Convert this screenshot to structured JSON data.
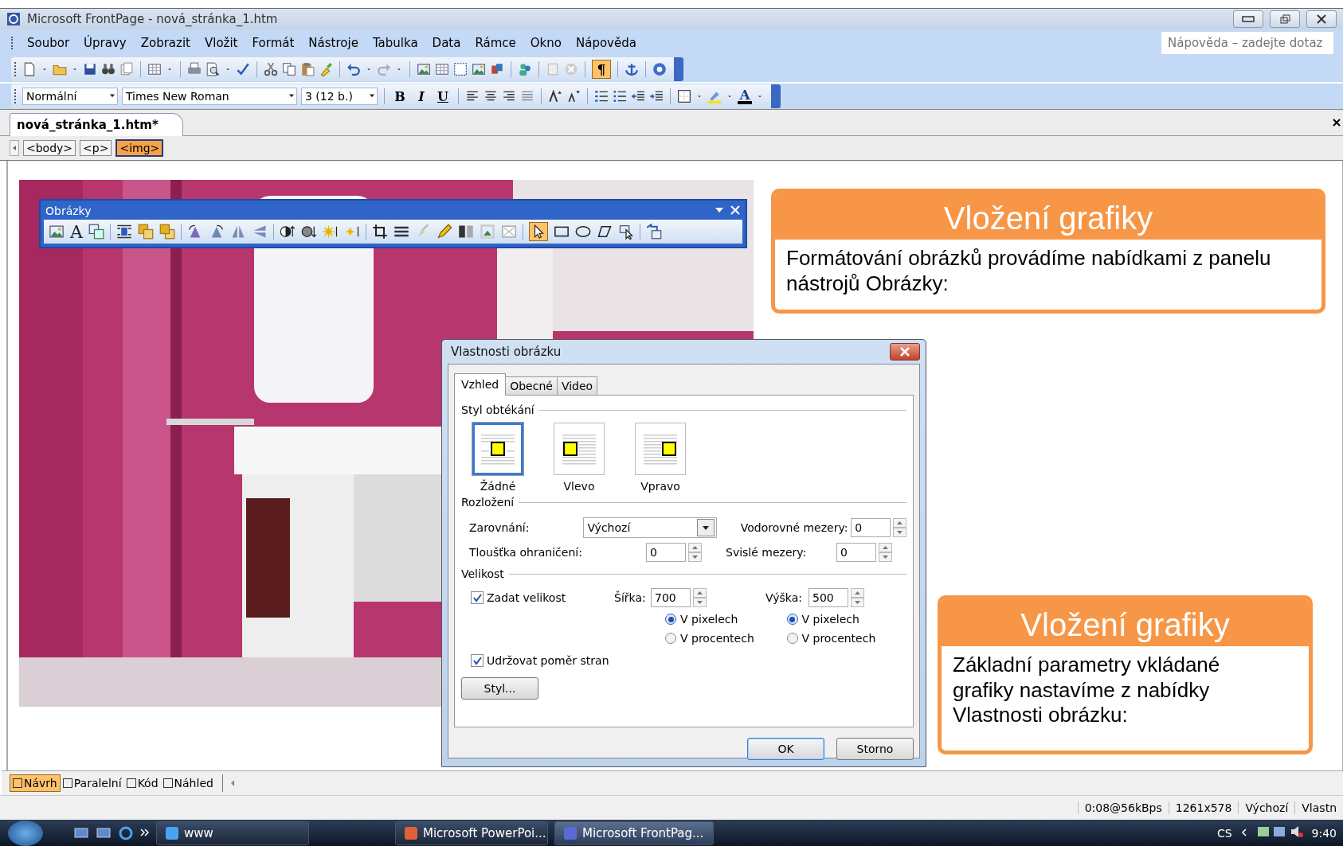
{
  "window": {
    "title": "Microsoft FrontPage - nová_stránka_1.htm"
  },
  "menu": [
    {
      "label": "Soubor"
    },
    {
      "label": "Úpravy"
    },
    {
      "label": "Zobrazit"
    },
    {
      "label": "Vložit"
    },
    {
      "label": "Formát"
    },
    {
      "label": "Nástroje"
    },
    {
      "label": "Tabulka"
    },
    {
      "label": "Data"
    },
    {
      "label": "Rámce"
    },
    {
      "label": "Okno"
    },
    {
      "label": "Nápověda"
    }
  ],
  "help_search": {
    "placeholder": "Nápověda – zadejte dotaz"
  },
  "toolbars": {
    "standard": {
      "pilcrow": {
        "label": "¶",
        "selected": true
      }
    },
    "formatting": {
      "style": "Normální",
      "font": "Times New Roman",
      "size": "3 (12 b.)",
      "buttons": [
        {
          "label": "B",
          "kind": "bold"
        },
        {
          "label": "I",
          "kind": "italic"
        },
        {
          "label": "U",
          "kind": "underline"
        }
      ],
      "font_color": {
        "label": "A"
      }
    }
  },
  "document_tab": {
    "label": "nová_stránka_1.htm*"
  },
  "tag_path": [
    {
      "label": "<body>",
      "selected": false
    },
    {
      "label": "<p>",
      "selected": false
    },
    {
      "label": "<img>",
      "selected": true
    }
  ],
  "pictures_toolbar": {
    "title": "Obrázky",
    "text_tool": "A",
    "pointer_selected": true
  },
  "callouts": [
    {
      "title": "Vložení grafiky",
      "text": "Formátování obrázků provádíme nabídkami z panelu nástrojů Obrázky:"
    },
    {
      "title": "Vložení grafiky",
      "text": "Základní parametry vkládané grafiky nastavíme z nabídky Vlastnosti obrázku:"
    }
  ],
  "dialog": {
    "title": "Vlastnosti obrázku",
    "tabs": [
      {
        "label": "Vzhled",
        "selected": true
      },
      {
        "label": "Obecné",
        "selected": false
      },
      {
        "label": "Video",
        "selected": false
      }
    ],
    "wrap_label": "Styl obtékání",
    "wrap_options": [
      {
        "label": "Žádné",
        "kind": "none",
        "selected": true
      },
      {
        "label": "Vlevo",
        "kind": "left",
        "selected": false
      },
      {
        "label": "Vpravo",
        "kind": "right",
        "selected": false
      }
    ],
    "layout_label": "Rozložení",
    "alignment": {
      "label": "Zarovnání:",
      "value": "Výchozí"
    },
    "border": {
      "label": "Tloušťka ohraničení:",
      "value": "0"
    },
    "hspace": {
      "label": "Vodorovné mezery:",
      "value": "0"
    },
    "vspace": {
      "label": "Svislé mezery:",
      "value": "0"
    },
    "size_label": "Velikost",
    "specify_size": {
      "label": "Zadat velikost",
      "checked": true
    },
    "width": {
      "label": "Šířka:",
      "value": "700",
      "units": [
        {
          "label": "V pixelech",
          "selected": true
        },
        {
          "label": "V procentech",
          "selected": false
        }
      ]
    },
    "height": {
      "label": "Výška:",
      "value": "500",
      "units": [
        {
          "label": "V pixelech",
          "selected": true
        },
        {
          "label": "V procentech",
          "selected": false
        }
      ]
    },
    "keep_ratio": {
      "label": "Udržovat poměr stran",
      "checked": true
    },
    "style_button": "Styl...",
    "buttons": [
      "OK",
      "Storno"
    ]
  },
  "view_tabs": [
    {
      "label": "Návrh",
      "selected": true
    },
    {
      "label": "Paralelní",
      "selected": false
    },
    {
      "label": "Kód",
      "selected": false
    },
    {
      "label": "Náhled",
      "selected": false
    }
  ],
  "status_bar": [
    "0:08@56kBps",
    "1261x578",
    "Výchozí",
    "Vlastn"
  ],
  "taskbar": {
    "items": [
      {
        "label": "www",
        "selected": false
      },
      {
        "label": "Microsoft PowerPoi...",
        "selected": false
      },
      {
        "label": "Microsoft FrontPag...",
        "selected": true
      }
    ],
    "language": "CS",
    "time": "9:40"
  }
}
